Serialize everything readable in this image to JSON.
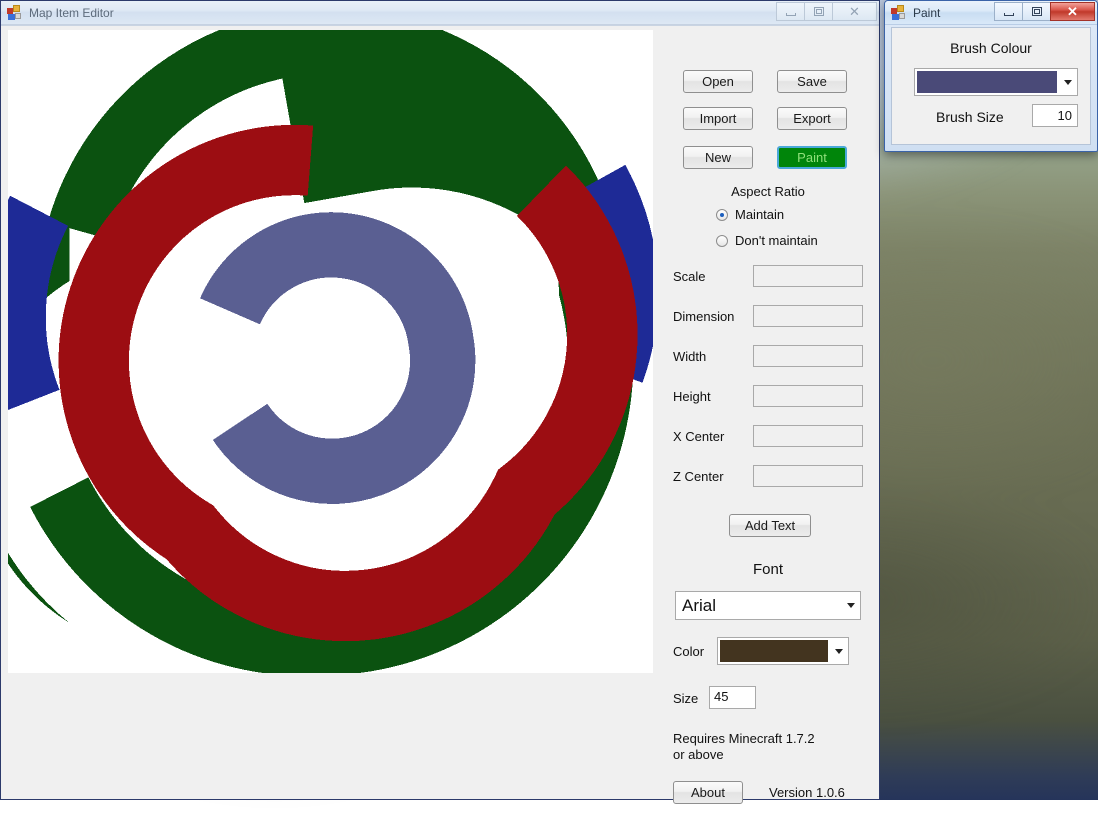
{
  "desktop": {
    "name": "blurred-wallpaper"
  },
  "main_window": {
    "title": "Map Item Editor",
    "icon": "app-icon",
    "active": false,
    "buttons": {
      "minimize": "—",
      "maximize": "□",
      "close": "✕"
    },
    "canvas": {
      "name": "map-preview-canvas",
      "background": "#ffffff",
      "colors": {
        "green": "#0b5210",
        "blue": "#1e2a96",
        "red": "#9c0d12",
        "purple": "#5a5f92"
      }
    },
    "toolbar": {
      "open": "Open",
      "save": "Save",
      "import": "Import",
      "export": "Export",
      "new": "New",
      "paint": "Paint",
      "paint_bg": "#00850a",
      "paint_fg": "#8fe07a",
      "paint_border": "#4aa8d8"
    },
    "aspect_ratio": {
      "title": "Aspect Ratio",
      "options": [
        {
          "label": "Maintain",
          "selected": true
        },
        {
          "label": "Don't maintain",
          "selected": false
        }
      ]
    },
    "fields": [
      {
        "label": "Scale",
        "value": "",
        "placeholder": ""
      },
      {
        "label": "Dimension",
        "value": "",
        "placeholder": ""
      },
      {
        "label": "Width",
        "value": "",
        "placeholder": ""
      },
      {
        "label": "Height",
        "value": "",
        "placeholder": ""
      },
      {
        "label": "X Center",
        "value": "",
        "placeholder": ""
      },
      {
        "label": "Z Center",
        "value": "",
        "placeholder": ""
      }
    ],
    "add_text_button": "Add Text",
    "font_section": {
      "title": "Font",
      "family": "Arial",
      "color_label": "Color",
      "color_value": "#43341f",
      "size_label": "Size",
      "size_value": "45"
    },
    "footer": {
      "requirement_line1": "Requires Minecraft 1.7.2",
      "requirement_line2": "or above",
      "about_button": "About",
      "version": "Version 1.0.6"
    }
  },
  "paint_window": {
    "title": "Paint",
    "icon": "app-icon",
    "active": true,
    "buttons": {
      "minimize": "—",
      "maximize": "□",
      "close": "✕"
    },
    "brush_colour_label": "Brush Colour",
    "brush_colour_value": "#4a4a78",
    "brush_size_label": "Brush Size",
    "brush_size_value": "10"
  }
}
